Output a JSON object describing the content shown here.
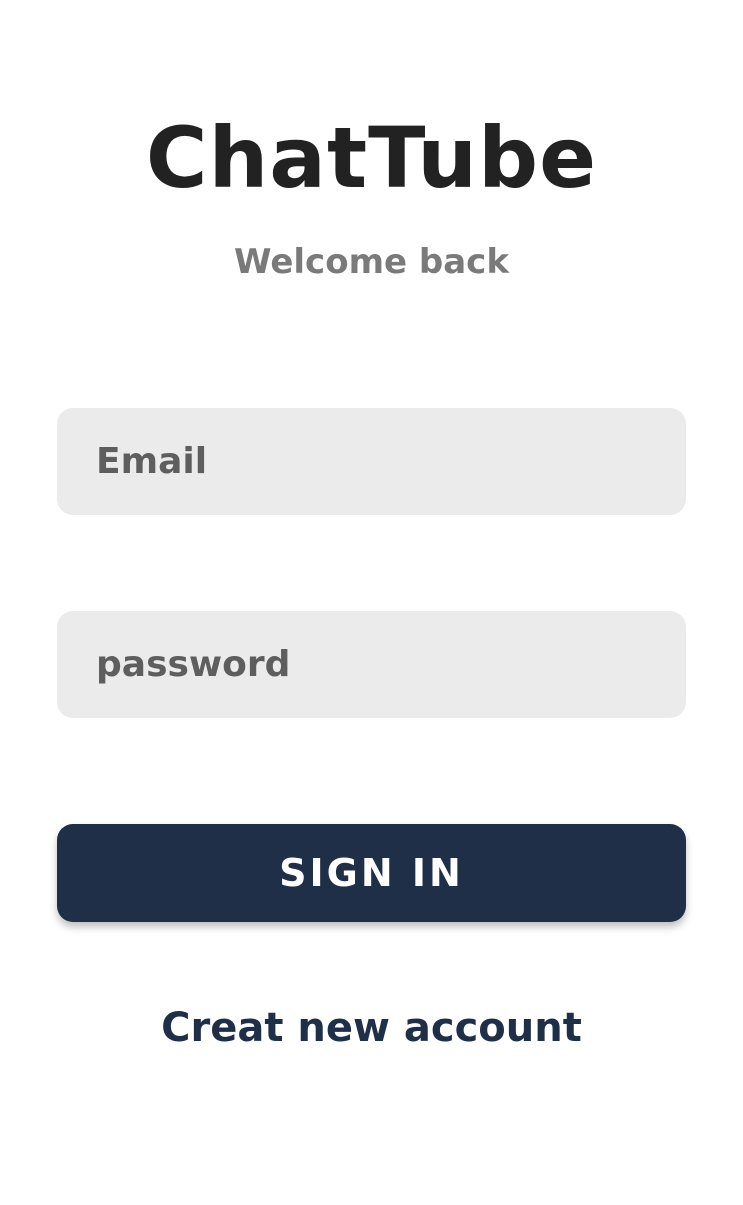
{
  "app": {
    "title": "ChatTube",
    "subtitle": "Welcome back"
  },
  "form": {
    "email": {
      "placeholder": "Email",
      "value": ""
    },
    "password": {
      "placeholder": "password",
      "value": ""
    },
    "sign_in_label": "SIGN IN",
    "create_account_label": "Creat new account"
  },
  "colors": {
    "background": "#ffffff",
    "title": "#222222",
    "subtitle": "#7a7a7a",
    "input_background": "#ebebeb",
    "input_text": "#5e5e5e",
    "primary": "#1f2f48",
    "button_text": "#ffffff"
  }
}
